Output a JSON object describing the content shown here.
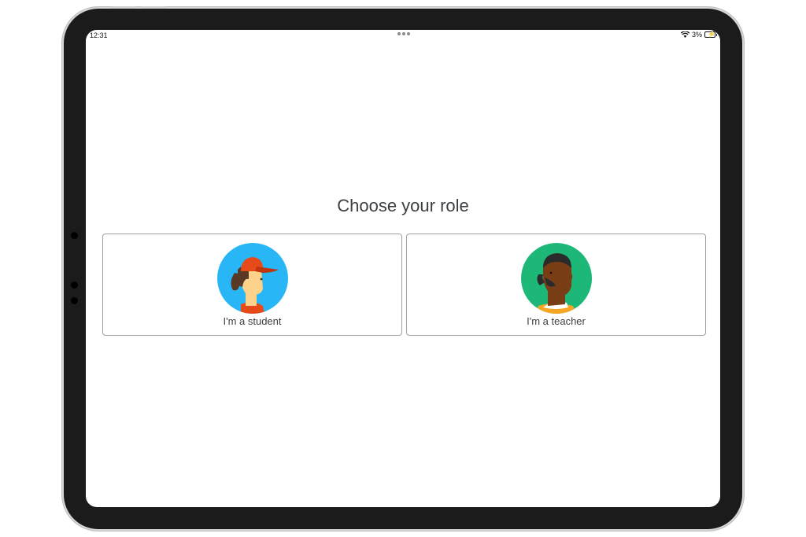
{
  "status_bar": {
    "time": "12:31",
    "battery_percent": "3%",
    "icons": [
      "wifi-icon",
      "battery-charging-icon"
    ]
  },
  "main": {
    "title": "Choose your role",
    "roles": [
      {
        "label": "I'm a student",
        "avatar": "student-avatar-icon"
      },
      {
        "label": "I'm a teacher",
        "avatar": "teacher-avatar-icon"
      }
    ]
  },
  "colors": {
    "student_bg": "#29b6f6",
    "teacher_bg": "#1db877",
    "cap": "#e64a19",
    "text": "#3c4043"
  }
}
